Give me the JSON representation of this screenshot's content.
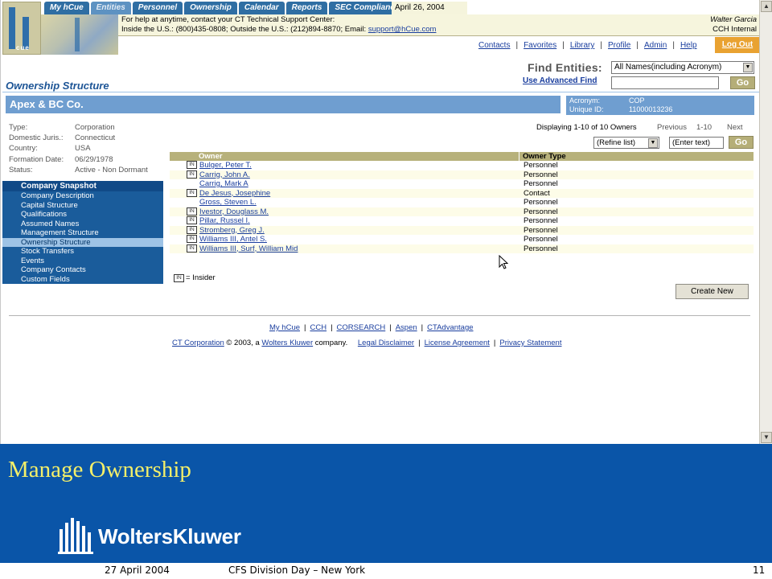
{
  "nav": {
    "tabs": [
      "My hCue",
      "Entities",
      "Personnel",
      "Ownership",
      "Calendar",
      "Reports",
      "SEC Compliance"
    ],
    "active_tab": "Entities",
    "date": "April 26, 2004"
  },
  "logo": {
    "text": "cue"
  },
  "help": {
    "line1": "For help at anytime, contact your CT Technical Support Center:",
    "line2": "Inside the U.S.: (800)435-0808; Outside the U.S.: (212)894-8870; Email: ",
    "email": "support@hCue.com",
    "user": "Walter Garcia",
    "org": "CCH Internal"
  },
  "toplinks": [
    "Contacts",
    "Favorites",
    "Library",
    "Profile",
    "Admin",
    "Help"
  ],
  "logout_label": "Log Out",
  "find": {
    "label": "Find Entities:",
    "select_value": "All Names(including Acronym)",
    "advanced_label": "Use Advanced Find",
    "go_label": "Go"
  },
  "page_title": "Ownership Structure",
  "entity": {
    "name": "Apex & BC Co.",
    "acronym_label": "Acronym:",
    "acronym": "COP",
    "uid_label": "Unique ID:",
    "uid": "11000013236"
  },
  "details": [
    {
      "label": "Type:",
      "value": "Corporation"
    },
    {
      "label": "Domestic Juris.:",
      "value": "Connecticut"
    },
    {
      "label": "Country:",
      "value": "USA"
    },
    {
      "label": "Formation Date:",
      "value": "06/29/1978"
    },
    {
      "label": "Status:",
      "value": "Active - Non Dormant"
    }
  ],
  "snapshot": {
    "heading": "Company Snapshot",
    "items": [
      "Company Description",
      "Capital Structure",
      "Qualifications",
      "Assumed Names",
      "Management Structure",
      "Ownership Structure",
      "Stock Transfers",
      "Events",
      "Company Contacts",
      "Custom Fields"
    ],
    "active": "Ownership Structure"
  },
  "owners": {
    "displaying": "Displaying 1-10 of 10 Owners",
    "previous": "Previous",
    "range": "1-10",
    "next": "Next",
    "refine_value": "(Refine list)",
    "filter_value": "(Enter text)",
    "go_label": "Go",
    "headers": [
      "Owner",
      "Owner Type"
    ],
    "badge": "IN",
    "rows": [
      {
        "name": "Bulger, Peter T.",
        "type": "Personnel",
        "insider": true
      },
      {
        "name": "Carrig, John A.",
        "type": "Personnel",
        "insider": true
      },
      {
        "name": "Carrig, Mark A",
        "type": "Personnel",
        "insider": false
      },
      {
        "name": "De Jesus, Josephine",
        "type": "Contact",
        "insider": true
      },
      {
        "name": "Gross, Steven L.",
        "type": "Personnel",
        "insider": false
      },
      {
        "name": "Ivestor, Douglass M.",
        "type": "Personnel",
        "insider": true
      },
      {
        "name": "Pillar, Russel I.",
        "type": "Personnel",
        "insider": true
      },
      {
        "name": "Stromberg, Greg J.",
        "type": "Personnel",
        "insider": true
      },
      {
        "name": "Williams III, Antel S.",
        "type": "Personnel",
        "insider": true
      },
      {
        "name": "Williams III, Surf, William Mid",
        "type": "Personnel",
        "insider": true
      }
    ],
    "legend": "= Insider",
    "create_label": "Create New"
  },
  "footer": {
    "links1": [
      "My hCue",
      "CCH",
      "CORSEARCH",
      "Aspen",
      "CTAdvantage"
    ],
    "ct_link": "CT Corporation",
    "copy1": " © 2003, a ",
    "wk_link": "Wolters Kluwer",
    "copy2": " company.",
    "links2": [
      "Legal Disclaimer",
      "License Agreement",
      "Privacy Statement"
    ]
  },
  "slide": {
    "title": "Manage Ownership",
    "brand": "WoltersKluwer",
    "date": "27 April 2004",
    "event": "CFS Division Day – New York",
    "page": "11"
  },
  "colors": {
    "nav_blue": "#2f6ea3",
    "banner_blue": "#6f9ed0",
    "header_tan": "#b7b17b",
    "logout_orange": "#e9a231",
    "slide_blue": "#0a55a8",
    "slide_title_yellow": "#f4ef69"
  }
}
